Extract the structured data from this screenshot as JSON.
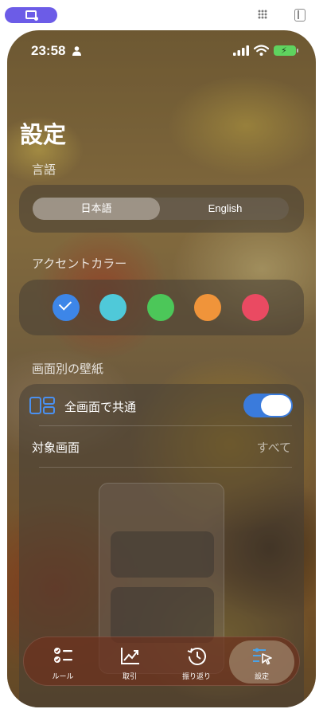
{
  "status_bar": {
    "time": "23:58"
  },
  "page": {
    "title": "設定"
  },
  "language": {
    "label": "言語",
    "options": [
      "日本語",
      "English"
    ],
    "selected": "日本語"
  },
  "accent": {
    "label": "アクセントカラー",
    "colors": [
      "#3d86e8",
      "#4fc9d9",
      "#4cc759",
      "#f0943a",
      "#ea4a62"
    ],
    "selected_index": 0
  },
  "wallpaper": {
    "label": "画面別の壁紙",
    "shared_label": "全画面で共通",
    "shared_enabled": true,
    "target_label": "対象画面",
    "target_value": "すべて"
  },
  "tabs": [
    {
      "label": "ルール",
      "icon": "checklist-icon"
    },
    {
      "label": "取引",
      "icon": "chart-up-icon"
    },
    {
      "label": "振り返り",
      "icon": "history-icon"
    },
    {
      "label": "設定",
      "icon": "sliders-cursor-icon",
      "active": true
    }
  ]
}
